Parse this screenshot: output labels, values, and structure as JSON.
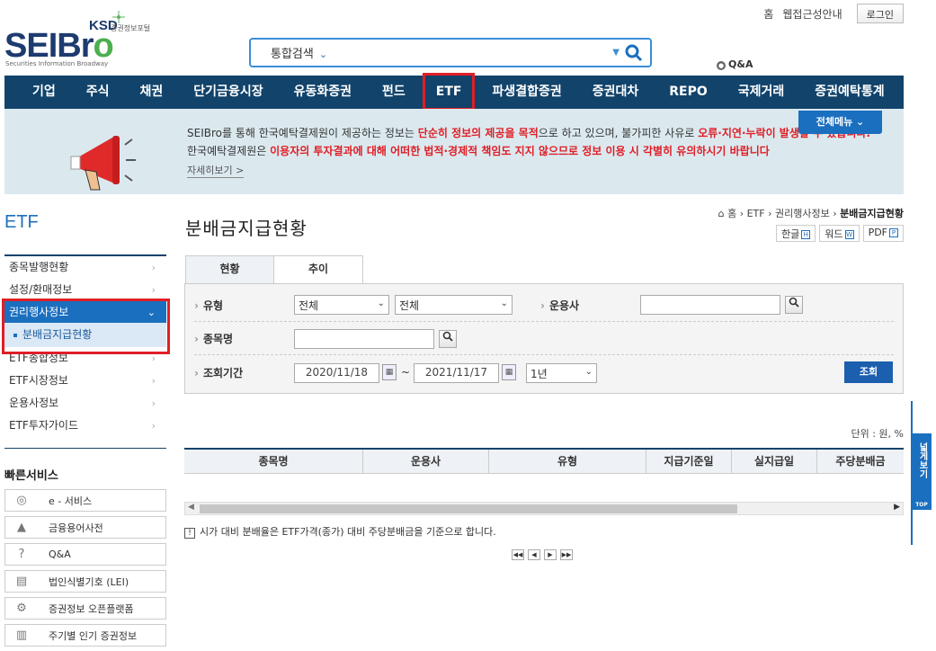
{
  "top": {
    "home": "홈",
    "accessibility": "웹접근성안내",
    "login": "로그인",
    "qna": "Q&A"
  },
  "logo": {
    "ksd": "KSD",
    "ksd_sub": "증권정보포털",
    "main_a": "SEIBr",
    "main_b": "o",
    "tagline": "Securities Information Broadway"
  },
  "search": {
    "category": "통합검색"
  },
  "gnb": [
    "기업",
    "주식",
    "채권",
    "단기금융시장",
    "유동화증권",
    "펀드",
    "ETF",
    "파생결합증권",
    "증권대차",
    "REPO",
    "국제거래",
    "증권예탁통계"
  ],
  "banner": {
    "l1_a": "SEIBro를 통해 한국예탁결제원이 제공하는 정보는 ",
    "l1_b": "단순히 정보의 제공을 목적",
    "l1_c": "으로 하고 있으며, 불가피한 사유로 ",
    "l1_d": "오류·지연·누락이 발생할 수 있습니다.",
    "l2_a": "한국예탁결제원은 ",
    "l2_b": "이용자의 투자결과에 대해 어떠한 법적·경제적 책임도 지지 않으므로 정보 이용 시 각별히 유의하시기 바랍니다",
    "more": "자세히보기 >",
    "all_menu": "전체메뉴"
  },
  "lnb": {
    "title": "ETF",
    "items": [
      "종목발행현황",
      "설정/환매정보",
      "권리행사정보"
    ],
    "sub": "분배금지급현황",
    "items2": [
      "ETF종합정보",
      "ETF시장정보",
      "운용사정보",
      "ETF투자가이드"
    ]
  },
  "quick": {
    "title": "빠른서비스",
    "items": [
      "e - 서비스",
      "금융용어사전",
      "Q&A",
      "법인식별기호 (LEI)",
      "증권정보 오픈플랫폼",
      "주기별 인기 증권정보"
    ]
  },
  "content": {
    "title": "분배금지급현황",
    "breadcrumb": [
      "홈",
      "ETF",
      "권리행사정보",
      "분배금지급현황"
    ],
    "docs": [
      "한글",
      "워드",
      "PDF"
    ],
    "tabs": [
      "현황",
      "추이"
    ]
  },
  "form": {
    "type_label": "유형",
    "type_val1": "전체",
    "type_val2": "전체",
    "manager_label": "운용사",
    "manager_value": "",
    "name_label": "종목명",
    "name_value": "",
    "period_label": "조회기간",
    "start": "2020/11/18",
    "tilde": "~",
    "end": "2021/11/17",
    "range": "1년",
    "search_btn": "조회"
  },
  "grid": {
    "unit": "단위 :  원, %",
    "headers": [
      "종목명",
      "운용사",
      "유형",
      "지급기준일",
      "실지급일",
      "주당분배금"
    ]
  },
  "note": "시가 대비 분배율은 ETF가격(종가) 대비 주당분배금을 기준으로 합니다.",
  "float": {
    "label": "넓게보기",
    "top": "TOP"
  }
}
